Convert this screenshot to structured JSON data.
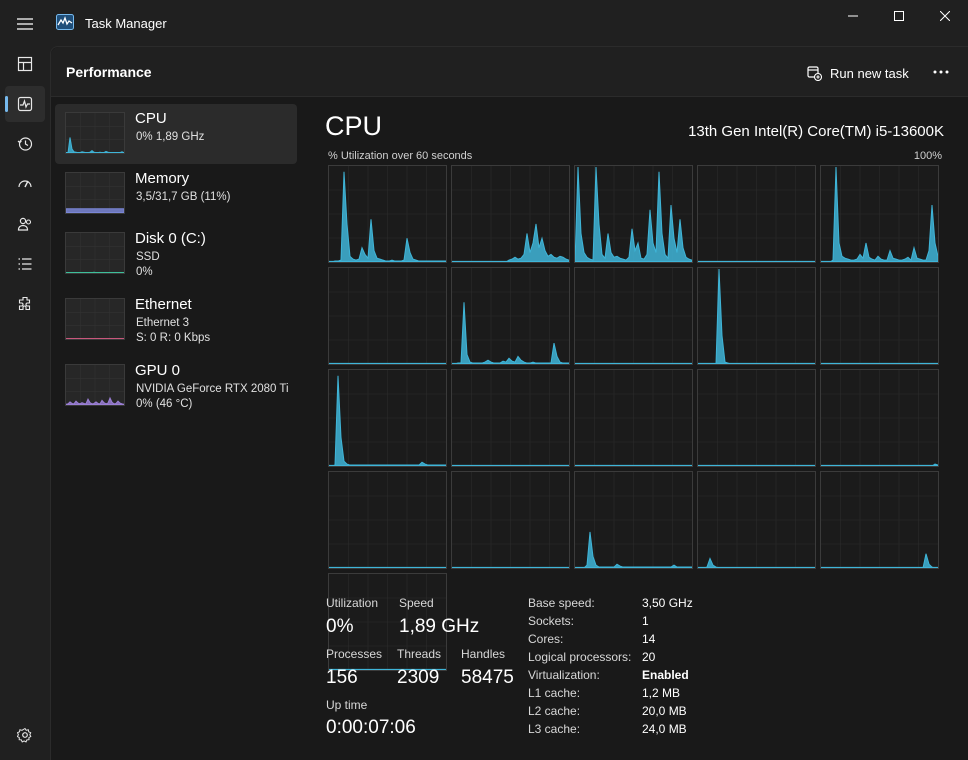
{
  "window": {
    "title": "Task Manager",
    "min_icon": "minimize-icon",
    "max_icon": "maximize-icon",
    "close_icon": "close-icon"
  },
  "nav": {
    "items": [
      {
        "icon": "processes-icon"
      },
      {
        "icon": "performance-icon",
        "active": true
      },
      {
        "icon": "app-history-icon"
      },
      {
        "icon": "startup-apps-icon"
      },
      {
        "icon": "users-icon"
      },
      {
        "icon": "details-icon"
      },
      {
        "icon": "services-icon"
      }
    ],
    "settings_icon": "gear-icon"
  },
  "header": {
    "title": "Performance",
    "run_task_label": "Run new task",
    "more_icon": "more-icon"
  },
  "devices": [
    {
      "name": "CPU",
      "line1": "0%  1,89 GHz",
      "line2": "",
      "color": "#3fb5d8",
      "selected": true
    },
    {
      "name": "Memory",
      "line1": "3,5/31,7 GB (11%)",
      "line2": "",
      "color": "#7a86d6"
    },
    {
      "name": "Disk 0 (C:)",
      "line1": "SSD",
      "line2": "0%",
      "color": "#3dbf9a"
    },
    {
      "name": "Ethernet",
      "line1": "Ethernet 3",
      "line2": "S: 0 R: 0 Kbps",
      "color": "#c9577c"
    },
    {
      "name": "GPU 0",
      "line1": "NVIDIA GeForce RTX 2080 Ti",
      "line2": "0%  (46 °C)",
      "color": "#9b7fd6"
    }
  ],
  "cpu": {
    "title": "CPU",
    "model": "13th Gen Intel(R) Core(TM) i5-13600K",
    "graph_label": "% Utilization over 60 seconds",
    "graph_max": "100%",
    "accent": "#3fb5d8",
    "stats": {
      "utilization_label": "Utilization",
      "utilization": "0%",
      "speed_label": "Speed",
      "speed": "1,89 GHz",
      "processes_label": "Processes",
      "processes": "156",
      "threads_label": "Threads",
      "threads": "2309",
      "handles_label": "Handles",
      "handles": "58475",
      "uptime_label": "Up time",
      "uptime": "0:00:07:06"
    },
    "specs": [
      {
        "label": "Base speed:",
        "value": "3,50 GHz",
        "bold": false
      },
      {
        "label": "Sockets:",
        "value": "1",
        "bold": false
      },
      {
        "label": "Cores:",
        "value": "14",
        "bold": false
      },
      {
        "label": "Logical processors:",
        "value": "20",
        "bold": false
      },
      {
        "label": "Virtualization:",
        "value": "Enabled",
        "bold": true
      },
      {
        "label": "L1 cache:",
        "value": "1,2 MB",
        "bold": false
      },
      {
        "label": "L2 cache:",
        "value": "20,0 MB",
        "bold": false
      },
      {
        "label": "L3 cache:",
        "value": "24,0 MB",
        "bold": false
      }
    ],
    "core_graphs": [
      [
        0,
        0,
        1,
        1,
        2,
        95,
        40,
        6,
        3,
        2,
        3,
        15,
        8,
        4,
        45,
        12,
        4,
        3,
        2,
        1,
        1,
        2,
        1,
        1,
        1,
        2,
        25,
        10,
        3,
        2,
        1,
        1,
        1,
        1,
        1,
        1,
        1,
        1,
        1,
        1
      ],
      [
        0,
        0,
        0,
        0,
        0,
        0,
        0,
        0,
        0,
        0,
        0,
        0,
        0,
        0,
        0,
        0,
        0,
        0,
        0,
        2,
        3,
        5,
        3,
        4,
        8,
        30,
        10,
        20,
        40,
        15,
        25,
        12,
        6,
        8,
        5,
        4,
        6,
        5,
        3,
        2
      ],
      [
        0,
        100,
        30,
        10,
        5,
        3,
        2,
        100,
        40,
        8,
        4,
        30,
        10,
        5,
        6,
        4,
        3,
        2,
        5,
        35,
        12,
        20,
        4,
        3,
        8,
        55,
        20,
        10,
        95,
        30,
        8,
        4,
        60,
        25,
        10,
        45,
        15,
        5,
        3,
        2
      ],
      [
        0,
        0,
        0,
        0,
        0,
        0,
        0,
        0,
        0,
        0,
        0,
        0,
        0,
        0,
        0,
        0,
        0,
        0,
        0,
        0,
        0,
        0,
        0,
        0,
        0,
        0,
        0,
        0,
        0,
        0,
        0,
        0,
        0,
        0,
        0,
        0,
        0,
        0,
        0,
        0
      ],
      [
        0,
        0,
        0,
        0,
        2,
        100,
        20,
        6,
        4,
        3,
        2,
        2,
        3,
        8,
        4,
        20,
        5,
        3,
        2,
        6,
        3,
        2,
        2,
        12,
        4,
        3,
        2,
        2,
        3,
        5,
        2,
        15,
        4,
        3,
        2,
        2,
        12,
        60,
        20,
        6
      ],
      [
        0,
        0,
        0,
        0,
        0,
        0,
        0,
        0,
        0,
        0,
        0,
        0,
        0,
        0,
        0,
        0,
        0,
        0,
        0,
        0,
        0,
        0,
        0,
        0,
        0,
        0,
        0,
        0,
        0,
        0,
        0,
        0,
        0,
        0,
        0,
        0,
        0,
        0,
        0,
        0
      ],
      [
        0,
        0,
        1,
        1,
        65,
        10,
        2,
        1,
        1,
        1,
        1,
        2,
        4,
        2,
        1,
        1,
        1,
        3,
        2,
        6,
        3,
        2,
        8,
        4,
        2,
        1,
        1,
        2,
        1,
        1,
        1,
        1,
        1,
        1,
        22,
        8,
        2,
        1,
        1,
        1
      ],
      [
        0,
        0,
        0,
        0,
        0,
        0,
        0,
        0,
        0,
        0,
        0,
        0,
        0,
        0,
        0,
        0,
        0,
        0,
        0,
        0,
        0,
        0,
        0,
        0,
        0,
        0,
        0,
        0,
        0,
        0,
        0,
        0,
        0,
        0,
        0,
        0,
        0,
        0,
        0,
        0
      ],
      [
        0,
        0,
        0,
        0,
        0,
        0,
        0,
        100,
        30,
        2,
        1,
        0,
        0,
        0,
        0,
        0,
        0,
        0,
        0,
        0,
        0,
        0,
        0,
        0,
        0,
        0,
        0,
        0,
        0,
        0,
        0,
        0,
        0,
        0,
        0,
        0,
        0,
        0,
        0,
        0
      ],
      [
        0,
        0,
        0,
        0,
        0,
        0,
        0,
        0,
        0,
        0,
        0,
        0,
        0,
        0,
        0,
        0,
        0,
        0,
        0,
        0,
        0,
        0,
        0,
        0,
        0,
        0,
        0,
        0,
        0,
        0,
        0,
        0,
        0,
        0,
        0,
        0,
        0,
        0,
        0,
        0
      ],
      [
        0,
        0,
        1,
        95,
        30,
        5,
        2,
        1,
        1,
        1,
        1,
        1,
        1,
        1,
        1,
        1,
        1,
        1,
        1,
        1,
        1,
        1,
        1,
        1,
        1,
        1,
        1,
        1,
        1,
        1,
        1,
        4,
        2,
        1,
        1,
        1,
        1,
        1,
        1,
        1
      ],
      [
        0,
        0,
        0,
        0,
        0,
        0,
        0,
        0,
        0,
        0,
        0,
        0,
        0,
        0,
        0,
        0,
        0,
        0,
        0,
        0,
        0,
        0,
        0,
        0,
        0,
        0,
        0,
        0,
        0,
        0,
        0,
        0,
        0,
        0,
        0,
        0,
        0,
        0,
        0,
        0
      ],
      [
        0,
        0,
        0,
        0,
        0,
        0,
        0,
        0,
        0,
        0,
        0,
        0,
        0,
        0,
        0,
        0,
        0,
        0,
        0,
        0,
        0,
        0,
        0,
        0,
        0,
        0,
        0,
        0,
        0,
        0,
        0,
        0,
        0,
        0,
        0,
        0,
        0,
        0,
        0,
        0
      ],
      [
        0,
        0,
        0,
        0,
        0,
        0,
        0,
        0,
        0,
        0,
        0,
        0,
        0,
        0,
        0,
        0,
        0,
        0,
        0,
        0,
        0,
        0,
        0,
        0,
        0,
        0,
        0,
        0,
        0,
        0,
        0,
        0,
        0,
        0,
        0,
        0,
        0,
        0,
        0,
        0
      ],
      [
        0,
        0,
        0,
        0,
        0,
        0,
        0,
        0,
        0,
        0,
        0,
        0,
        0,
        0,
        0,
        0,
        0,
        0,
        0,
        0,
        0,
        0,
        0,
        0,
        0,
        0,
        0,
        0,
        0,
        0,
        0,
        0,
        0,
        0,
        0,
        0,
        0,
        0,
        2,
        1
      ],
      [
        0,
        0,
        0,
        0,
        0,
        0,
        0,
        0,
        0,
        0,
        0,
        0,
        0,
        0,
        0,
        0,
        0,
        0,
        0,
        0,
        0,
        0,
        0,
        0,
        0,
        0,
        0,
        0,
        0,
        0,
        0,
        0,
        0,
        0,
        0,
        0,
        0,
        0,
        0,
        0
      ],
      [
        0,
        0,
        0,
        0,
        0,
        0,
        0,
        0,
        0,
        0,
        0,
        0,
        0,
        0,
        0,
        0,
        0,
        0,
        0,
        0,
        0,
        0,
        0,
        0,
        0,
        0,
        0,
        0,
        0,
        0,
        0,
        0,
        0,
        0,
        0,
        0,
        0,
        0,
        0,
        0
      ],
      [
        0,
        0,
        0,
        0,
        3,
        38,
        12,
        3,
        1,
        1,
        1,
        1,
        1,
        1,
        4,
        2,
        1,
        1,
        1,
        1,
        1,
        1,
        1,
        1,
        1,
        1,
        1,
        1,
        1,
        1,
        1,
        1,
        1,
        3,
        1,
        1,
        1,
        1,
        1,
        1
      ],
      [
        0,
        0,
        0,
        1,
        10,
        3,
        1,
        0,
        0,
        0,
        0,
        0,
        0,
        0,
        0,
        0,
        0,
        0,
        0,
        0,
        0,
        0,
        0,
        0,
        0,
        0,
        0,
        0,
        0,
        0,
        0,
        0,
        0,
        0,
        0,
        0,
        0,
        0,
        0,
        0
      ],
      [
        0,
        0,
        0,
        0,
        0,
        0,
        0,
        0,
        0,
        0,
        0,
        0,
        0,
        0,
        0,
        0,
        0,
        0,
        0,
        0,
        0,
        0,
        0,
        0,
        0,
        0,
        0,
        0,
        0,
        0,
        0,
        0,
        0,
        0,
        0,
        15,
        4,
        1,
        0,
        0
      ],
      [
        0,
        0,
        0,
        0,
        0,
        0,
        0,
        0,
        0,
        0,
        0,
        0,
        0,
        0,
        0,
        0,
        0,
        0,
        0,
        0,
        0,
        0,
        0,
        0,
        0,
        0,
        0,
        0,
        0,
        0,
        0,
        0,
        0,
        0,
        0,
        0,
        0,
        0,
        0,
        0
      ]
    ],
    "thumb_series": {
      "cpu": [
        0,
        0,
        40,
        10,
        3,
        2,
        1,
        1,
        3,
        2,
        1,
        1,
        2,
        6,
        2,
        1,
        1,
        2,
        1,
        1,
        4,
        2,
        1,
        1,
        1,
        1,
        1,
        1,
        3,
        1
      ],
      "memory": [
        11,
        11,
        11,
        11,
        11,
        11,
        11,
        11,
        11,
        11,
        11,
        11,
        11,
        11,
        11,
        11,
        11,
        11,
        11,
        11,
        11,
        11,
        11,
        11,
        11,
        11,
        11,
        11,
        11,
        11
      ],
      "disk": [
        0,
        0,
        0,
        0,
        0,
        0,
        0,
        0,
        0,
        0,
        0,
        0,
        0,
        0,
        2,
        0,
        0,
        0,
        0,
        0,
        0,
        0,
        0,
        0,
        0,
        0,
        0,
        0,
        0,
        0
      ],
      "ethernet": [
        1,
        1,
        1,
        1,
        1,
        1,
        1,
        1,
        1,
        1,
        1,
        1,
        1,
        1,
        1,
        1,
        1,
        1,
        1,
        1,
        1,
        1,
        1,
        1,
        1,
        1,
        1,
        1,
        1,
        1
      ],
      "gpu": [
        2,
        3,
        8,
        4,
        3,
        10,
        5,
        3,
        6,
        4,
        3,
        15,
        6,
        3,
        4,
        8,
        4,
        3,
        12,
        6,
        3,
        5,
        18,
        7,
        3,
        4,
        10,
        5,
        3,
        2
      ]
    }
  }
}
